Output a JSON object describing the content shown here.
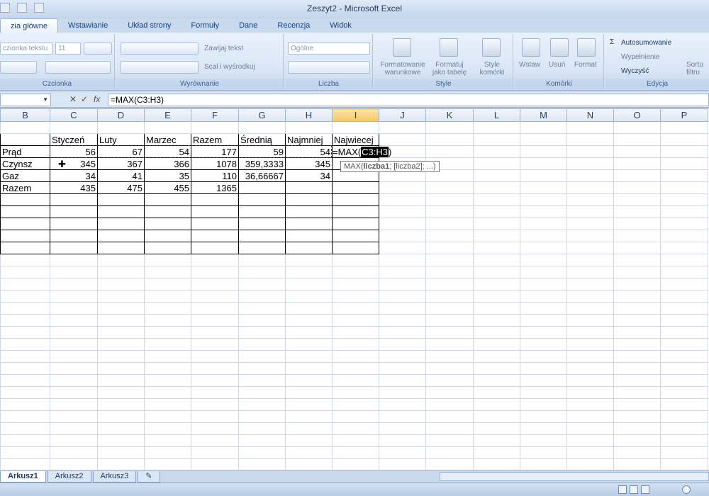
{
  "window": {
    "title": "Zeszyt2 - Microsoft Excel"
  },
  "tabs": [
    {
      "label": "zia główne",
      "active": true
    },
    {
      "label": "Wstawianie"
    },
    {
      "label": "Układ strony"
    },
    {
      "label": "Formuły"
    },
    {
      "label": "Dane"
    },
    {
      "label": "Recenzja"
    },
    {
      "label": "Widok"
    }
  ],
  "ribbon": {
    "czcionka": {
      "label": "Czcionka",
      "font_name": "czionka tekstu",
      "font_size": "11"
    },
    "wyrownanie": {
      "label": "Wyrównanie",
      "wrap_text": "Zawijaj tekst",
      "merge": "Scal i wyśrodkuj"
    },
    "liczba": {
      "label": "Liczba",
      "format": "Ogólne"
    },
    "style": {
      "label": "Style",
      "conditional": "Formatowanie\nwarunkowe",
      "format_table": "Formatuj\njako tabelę",
      "cell_styles": "Style\nkomórki"
    },
    "komorki": {
      "label": "Komórki",
      "insert": "Wstaw",
      "delete": "Usuń",
      "format": "Format"
    },
    "edycja": {
      "label": "Edycja",
      "autosum": "Autosumowanie",
      "fill": "Wypełnienie",
      "clear": "Wyczyść",
      "sort": "Sortu\nfiltru"
    }
  },
  "formula_bar": {
    "name_box": "",
    "formula": "=MAX(C3:H3)"
  },
  "columns": [
    "B",
    "C",
    "D",
    "E",
    "F",
    "G",
    "H",
    "I",
    "J",
    "K",
    "L",
    "M",
    "N",
    "O",
    "P"
  ],
  "selected_column": "I",
  "table": {
    "headers": [
      "",
      "Styczeń",
      "Luty",
      "Marzec",
      "Razem",
      "Średnią",
      "Najmniej",
      "Najwiecej"
    ],
    "rows": [
      [
        "Prąd",
        "56",
        "67",
        "54",
        "177",
        "59",
        "54",
        ""
      ],
      [
        "Czynsz",
        "345",
        "367",
        "366",
        "1078",
        "359,3333",
        "345",
        ""
      ],
      [
        "Gaz",
        "34",
        "41",
        "35",
        "110",
        "36,66667",
        "34",
        ""
      ],
      [
        "Razem",
        "435",
        "475",
        "455",
        "1365",
        "",
        "",
        ""
      ]
    ]
  },
  "editing": {
    "prefix": "=MAX(",
    "ref": "C3:H3",
    "suffix": ")"
  },
  "tooltip": {
    "fn": "MAX(",
    "arg1": "liczba1",
    "rest": "; [liczba2]; ...)"
  },
  "sheets": [
    {
      "label": "Arkusz1",
      "active": true
    },
    {
      "label": "Arkusz2"
    },
    {
      "label": "Arkusz3"
    }
  ]
}
